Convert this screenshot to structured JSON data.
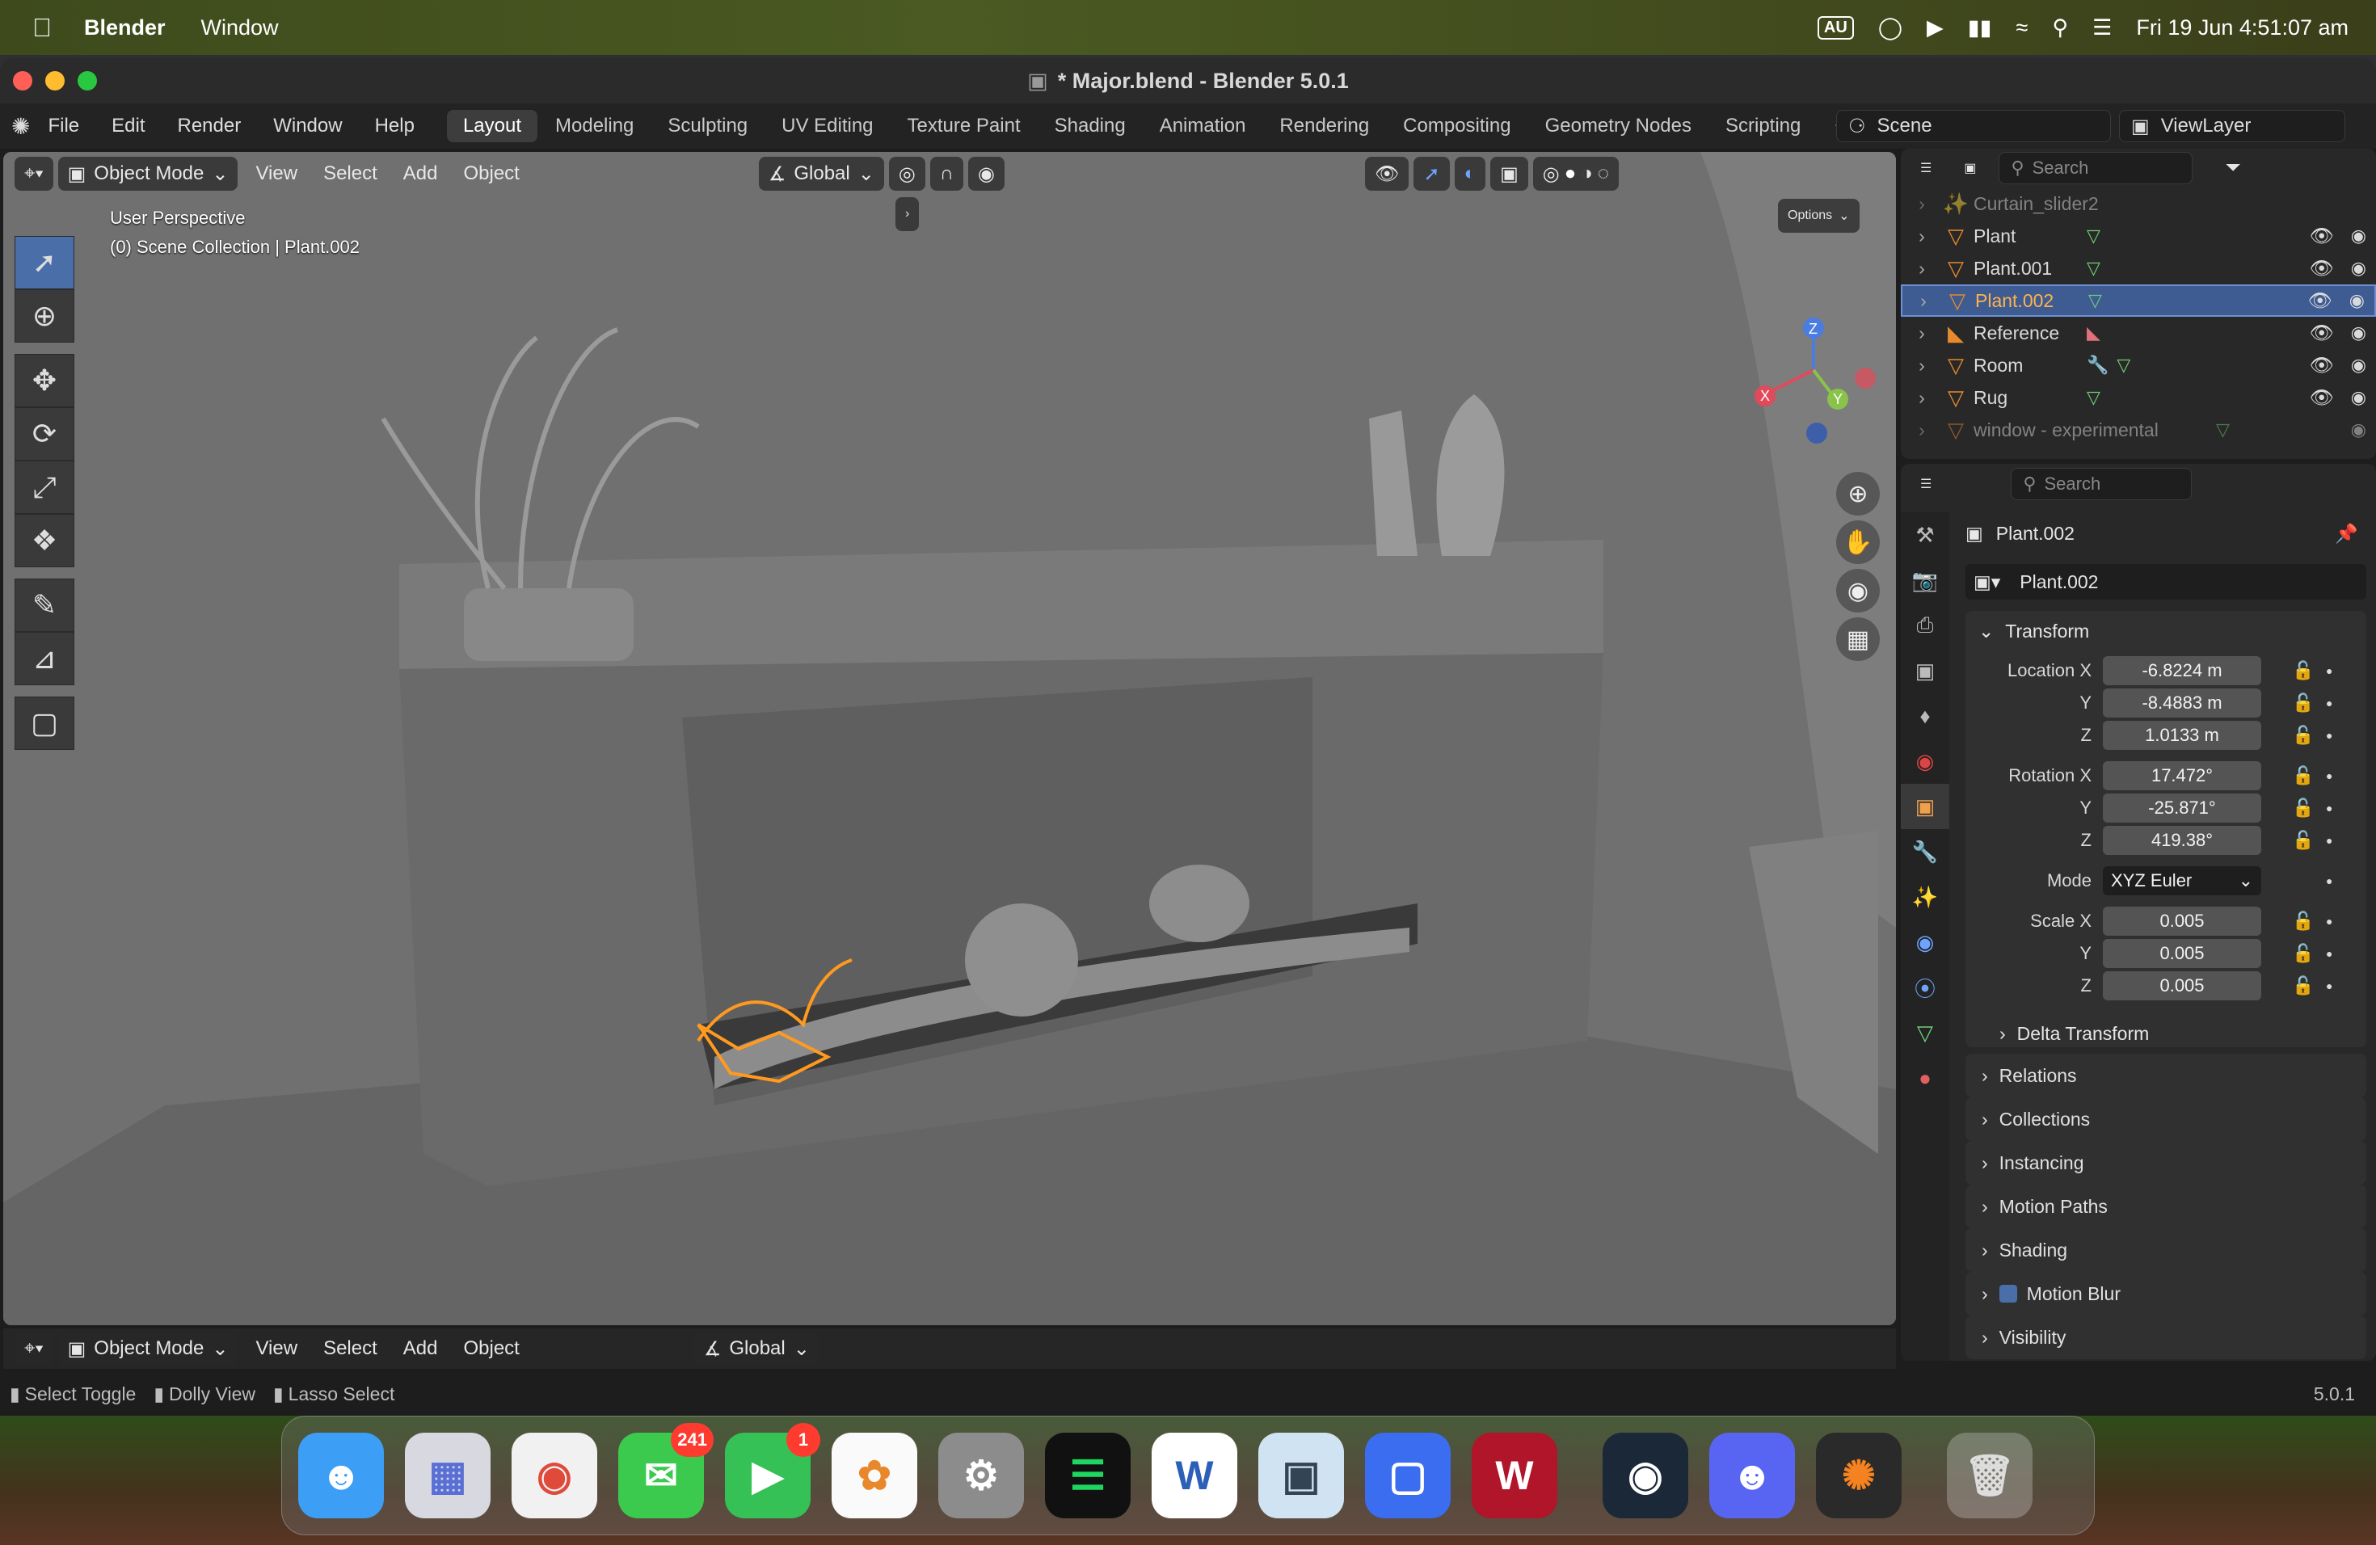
{
  "macmenu": {
    "app": "Blender",
    "items": [
      "Window"
    ],
    "input_source": "AU",
    "clock": "Fri 19 Jun  4:51:07 am"
  },
  "window": {
    "title": "* Major.blend - Blender 5.0.1"
  },
  "topbar": {
    "menus": [
      "File",
      "Edit",
      "Render",
      "Window",
      "Help"
    ],
    "workspaces": [
      "Layout",
      "Modeling",
      "Sculpting",
      "UV Editing",
      "Texture Paint",
      "Shading",
      "Animation",
      "Rendering",
      "Compositing",
      "Geometry Nodes",
      "Scripting"
    ],
    "add_tab": "+",
    "scene": "Scene",
    "view_layer": "ViewLayer"
  },
  "viewport": {
    "mode": "Object Mode",
    "menus": [
      "View",
      "Select",
      "Add",
      "Object"
    ],
    "orientation": "Global",
    "options": "Options",
    "overlay_line1": "User Perspective",
    "overlay_line2": "(0) Scene Collection | Plant.002",
    "gizmo": {
      "x": "X",
      "y": "Y",
      "z": "Z"
    }
  },
  "bottom_header": {
    "mode": "Object Mode",
    "menus": [
      "View",
      "Select",
      "Add",
      "Object"
    ],
    "orientation": "Global"
  },
  "outliner": {
    "search": "Search",
    "rows": [
      {
        "label": "Curtain_slider2",
        "dim": true
      },
      {
        "label": "Plant"
      },
      {
        "label": "Plant.001"
      },
      {
        "label": "Plant.002",
        "selected": true
      },
      {
        "label": "Reference"
      },
      {
        "label": "Room"
      },
      {
        "label": "Rug"
      },
      {
        "label": "window - experimental",
        "dim": true
      }
    ]
  },
  "properties": {
    "search": "Search",
    "object_name": "Plant.002",
    "datablock": "Plant.002",
    "transform": {
      "header": "Transform",
      "location_label": "Location X",
      "location": [
        "-6.8224 m",
        "-8.4883 m",
        "1.0133 m"
      ],
      "rotation_label": "Rotation X",
      "rotation": [
        "17.472°",
        "-25.871°",
        "419.38°"
      ],
      "mode_label": "Mode",
      "mode": "XYZ Euler",
      "scale_label": "Scale X",
      "scale": [
        "0.005",
        "0.005",
        "0.005"
      ],
      "y": "Y",
      "z": "Z",
      "delta": "Delta Transform"
    },
    "sections": [
      "Relations",
      "Collections",
      "Instancing",
      "Motion Paths",
      "Shading",
      "Motion Blur",
      "Visibility"
    ]
  },
  "status": {
    "items": [
      "Select Toggle",
      "Dolly View",
      "Lasso Select"
    ],
    "version": "5.0.1"
  },
  "dock": {
    "messages_badge": "241",
    "facetime_badge": "1"
  }
}
